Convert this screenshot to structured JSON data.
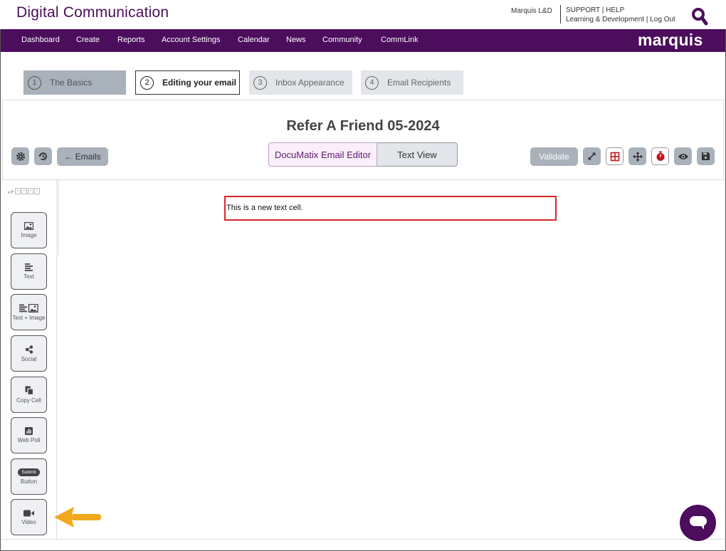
{
  "header": {
    "app_title": "Digital Communication",
    "user_name": "Marquis L&D",
    "support": "SUPPORT",
    "help": "HELP",
    "org": "Learning & Development",
    "logout": "Log Out",
    "sep": "|"
  },
  "nav": {
    "items": [
      "Dashboard",
      "Create",
      "Reports",
      "Account Settings",
      "Calendar",
      "News",
      "Community",
      "CommLink"
    ],
    "brand": "marquis"
  },
  "steps": [
    {
      "num": "1",
      "label": "The Basics"
    },
    {
      "num": "2",
      "label": "Editing your email"
    },
    {
      "num": "3",
      "label": "Inbox Appearance"
    },
    {
      "num": "4",
      "label": "Email Recipients"
    }
  ],
  "editor": {
    "email_title": "Refer A Friend 05-2024",
    "emails_button": "← Emails",
    "mode_editor": "DocuMatix Email Editor",
    "mode_text": "Text View",
    "validate": "Validate"
  },
  "toolbox": {
    "tools": [
      {
        "label": "Image",
        "icon": "image-icon"
      },
      {
        "label": "Text",
        "icon": "text-lines-icon"
      },
      {
        "label": "Text + Image",
        "icon": "text-image-icon"
      },
      {
        "label": "Social",
        "icon": "share-icon"
      },
      {
        "label": "Copy Cell",
        "icon": "copy-icon"
      },
      {
        "label": "Web Poll",
        "icon": "poll-chart-icon"
      },
      {
        "label": "Button",
        "icon": "submit-button-icon",
        "badge": "Submit"
      },
      {
        "label": "Video",
        "icon": "video-camera-icon"
      }
    ]
  },
  "canvas": {
    "text_cell": "This is a new text cell."
  },
  "colors": {
    "brand_purple": "#4b0d5c",
    "title_purple": "#4a0d57",
    "button_gray": "#a9b1bb",
    "cell_border_red": "#d9252a",
    "annotation_orange": "#f2a91d"
  }
}
